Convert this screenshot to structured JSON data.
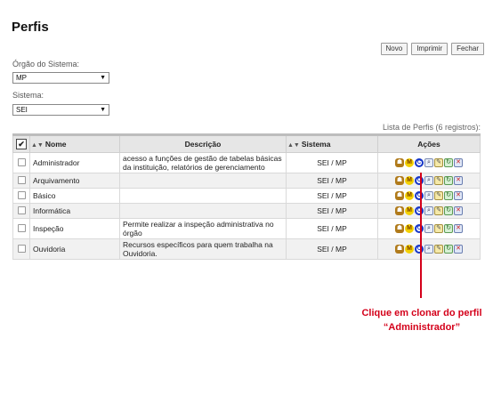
{
  "page": {
    "title": "Perfis"
  },
  "toolbar": {
    "new_label": "Novo",
    "print_label": "Imprimir",
    "close_label": "Fechar"
  },
  "filters": {
    "orgao_label": "Órgão do Sistema:",
    "orgao_value": "MP",
    "sistema_label": "Sistema:",
    "sistema_value": "SEI"
  },
  "table": {
    "caption": "Lista de Perfis (6 registros):",
    "headers": {
      "nome": "Nome",
      "descricao": "Descrição",
      "sistema": "Sistema",
      "acoes": "Ações"
    },
    "rows": [
      {
        "nome": "Administrador",
        "descricao": "acesso a funções de gestão de tabelas básicas da instituição, relatórios de gerenciamento",
        "sistema": "SEI / MP"
      },
      {
        "nome": "Arquivamento",
        "descricao": "",
        "sistema": "SEI / MP"
      },
      {
        "nome": "Básico",
        "descricao": "",
        "sistema": "SEI / MP"
      },
      {
        "nome": "Informática",
        "descricao": "",
        "sistema": "SEI / MP"
      },
      {
        "nome": "Inspeção",
        "descricao": "Permite realizar a inspeção administrativa no órgão",
        "sistema": "SEI / MP"
      },
      {
        "nome": "Ouvidoria",
        "descricao": "Recursos específicos para quem trabalha na Ouvidoria.",
        "sistema": "SEI / MP"
      }
    ],
    "action_icons": [
      "permissions-icon",
      "menu-icon",
      "clone-icon",
      "view-icon",
      "edit-icon",
      "reactivate-icon",
      "delete-icon"
    ]
  },
  "annotation": {
    "line1": "Clique em clonar  do perfil",
    "line2": "“Administrador”",
    "color": "#d4001a"
  }
}
